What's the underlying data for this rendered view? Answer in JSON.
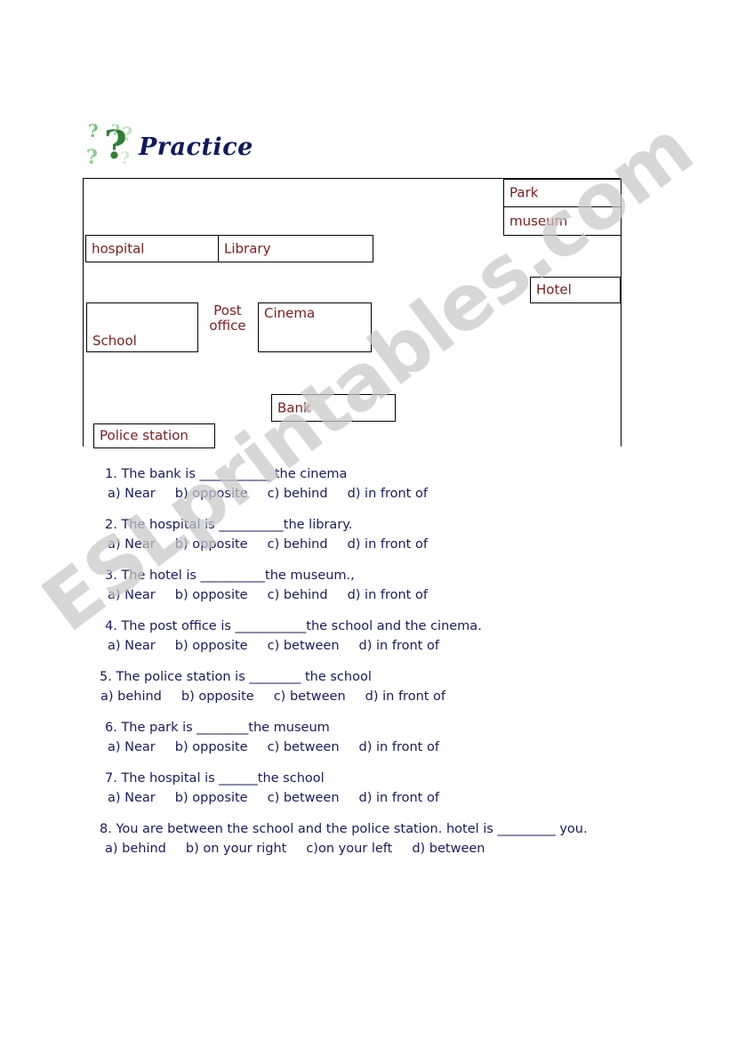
{
  "header": {
    "title": "Practice",
    "icon": "question-marks-icon"
  },
  "watermark": {
    "text": "ESLprintables.com"
  },
  "map": {
    "boxes": [
      {
        "name": "hospital",
        "label": "hospital"
      },
      {
        "name": "library",
        "label": "Library"
      },
      {
        "name": "park",
        "label": "Park"
      },
      {
        "name": "museum",
        "label": "museum"
      },
      {
        "name": "hotel",
        "label": "Hotel"
      },
      {
        "name": "school",
        "label": "School"
      },
      {
        "name": "cinema",
        "label": "Cinema"
      },
      {
        "name": "bank",
        "label": "Bank"
      },
      {
        "name": "police-station",
        "label": "Police station"
      }
    ],
    "post_office": "Post office",
    "post_office_line1": "Post",
    "post_office_line2": "office"
  },
  "questions": [
    {
      "number": "1.",
      "stem": "1.  The bank is ___________ the cinema",
      "options": [
        "a) Near",
        "b) opposite",
        "c) behind",
        "d) in front of"
      ]
    },
    {
      "number": "2.",
      "stem": "2.  The hospital is __________the library.",
      "options": [
        "a) Near",
        "b) opposite",
        "c) behind",
        "d) in front of"
      ]
    },
    {
      "number": "3.",
      "stem": "3.  The hotel is __________the museum.,",
      "options": [
        "a) Near",
        "b) opposite",
        "c) behind",
        "d) in front of"
      ]
    },
    {
      "number": "4.",
      "stem": "4.  The post office is ___________the school and the cinema.",
      "options": [
        "a) Near",
        "b) opposite",
        "c) between",
        "d) in front of"
      ]
    },
    {
      "number": "5.",
      "stem": "5. The police station is ________ the school",
      "options": [
        "a) behind",
        "b) opposite",
        "c) between",
        "d) in front of"
      ]
    },
    {
      "number": "6.",
      "stem": "6.  The park is ________the museum",
      "options": [
        "a) Near",
        "b) opposite",
        "c) between",
        "d) in front of"
      ]
    },
    {
      "number": "7.",
      "stem": "7.  The hospital is ______the school",
      "options": [
        "a) Near",
        "b) opposite",
        "c) between",
        "d) in front of"
      ]
    },
    {
      "number": "8.",
      "stem": "8. You are between the school and the police station. hotel is _________ you.",
      "options": [
        "a) behind",
        "b) on your right",
        "c)on your left",
        "d) between"
      ]
    }
  ],
  "colors": {
    "map_label": "#7b2020",
    "question_text": "#1a1a5e",
    "title": "#11195e",
    "watermark": "#c9c9c9",
    "icon_green_dark": "#2f7d32",
    "icon_green_light": "#a6d8a8"
  }
}
